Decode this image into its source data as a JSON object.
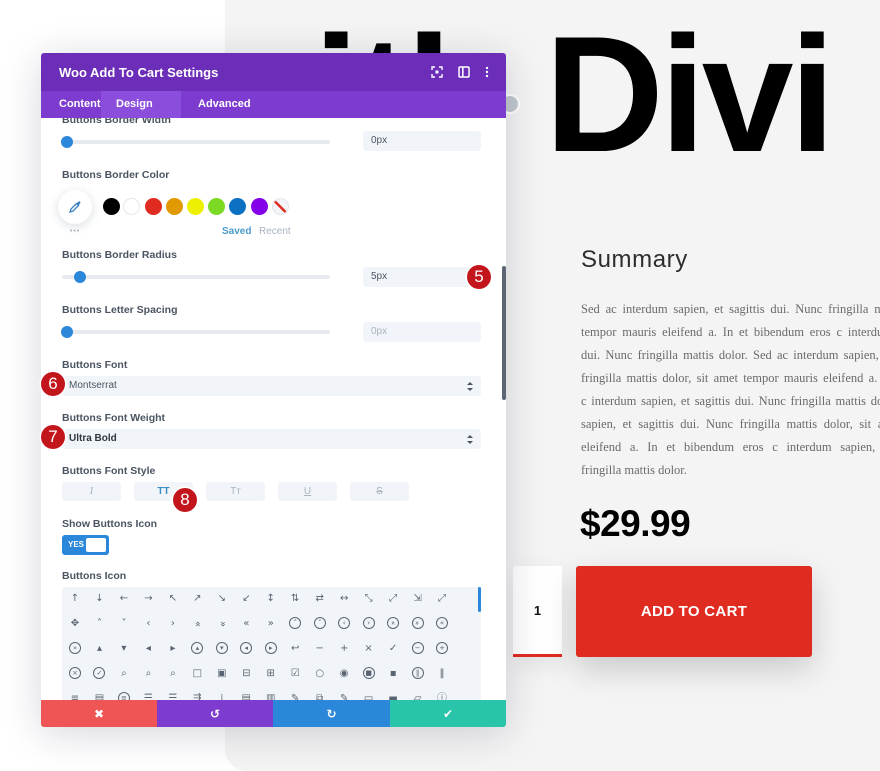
{
  "panel": {
    "title": "Woo Add To Cart Settings",
    "header_icons": [
      "expand-icon",
      "split-view-icon",
      "more-options-icon"
    ],
    "tabs": [
      {
        "label": "Content",
        "active": false
      },
      {
        "label": "Design",
        "active": true
      },
      {
        "label": "Advanced",
        "active": false
      }
    ],
    "fields": {
      "border_width": {
        "label": "Buttons Border Width",
        "value": "0px",
        "slider_position": 0
      },
      "border_color": {
        "label": "Buttons Border Color",
        "more_label": "•••",
        "saved_label": "Saved",
        "recent_label": "Recent",
        "swatches": [
          {
            "name": "black",
            "hex": "#000000"
          },
          {
            "name": "white",
            "hex": "#ffffff"
          },
          {
            "name": "red",
            "hex": "#e02b20"
          },
          {
            "name": "orange",
            "hex": "#e09900"
          },
          {
            "name": "yellow",
            "hex": "#edf000"
          },
          {
            "name": "green",
            "hex": "#7cda24"
          },
          {
            "name": "blue",
            "hex": "#0c71c3"
          },
          {
            "name": "purple",
            "hex": "#8300e9"
          },
          {
            "name": "transparent",
            "hex": "transparent"
          }
        ]
      },
      "border_radius": {
        "label": "Buttons Border Radius",
        "value": "5px",
        "slider_position": 0.05
      },
      "letter_spacing": {
        "label": "Buttons Letter Spacing",
        "value": "0px",
        "slider_position": 0
      },
      "font": {
        "label": "Buttons Font",
        "value": "Montserrat"
      },
      "font_weight": {
        "label": "Buttons Font Weight",
        "value": "Ultra Bold"
      },
      "font_style": {
        "label": "Buttons Font Style",
        "options": [
          {
            "name": "italic",
            "glyph": "I",
            "active": false
          },
          {
            "name": "uppercase",
            "glyph": "TT",
            "active": true
          },
          {
            "name": "capitalize",
            "glyph": "Tт",
            "active": false
          },
          {
            "name": "underline",
            "glyph": "U",
            "active": false
          },
          {
            "name": "strikethrough",
            "glyph": "S",
            "active": false
          }
        ]
      },
      "show_icon": {
        "label": "Show Buttons Icon",
        "value": "YES",
        "on": true
      },
      "icon": {
        "label": "Buttons Icon",
        "rows": [
          [
            {
              "n": "arrow-up",
              "g": "↑"
            },
            {
              "n": "arrow-down",
              "g": "↓"
            },
            {
              "n": "arrow-left",
              "g": "←"
            },
            {
              "n": "arrow-right",
              "g": "→"
            },
            {
              "n": "arrow-up-left",
              "g": "↖"
            },
            {
              "n": "arrow-up-right",
              "g": "↗"
            },
            {
              "n": "arrow-down-right",
              "g": "↘"
            },
            {
              "n": "arrow-down-left",
              "g": "↙"
            },
            {
              "n": "arrow-up-down",
              "g": "↕"
            },
            {
              "n": "arrows-up-down-offset",
              "g": "⇅"
            },
            {
              "n": "arrows-left-right-offset",
              "g": "⇄"
            },
            {
              "n": "arrow-left-right",
              "g": "↔"
            },
            {
              "n": "arrow-diagonal-nw-se",
              "g": "⤡"
            },
            {
              "n": "arrow-diagonal-ne-sw",
              "g": "⤢"
            },
            {
              "n": "compress",
              "g": "⇲"
            },
            {
              "n": "expand",
              "g": "⤢"
            }
          ],
          [
            {
              "n": "move",
              "g": "✥"
            },
            {
              "n": "chevron-up",
              "g": "˄"
            },
            {
              "n": "chevron-down",
              "g": "˅"
            },
            {
              "n": "chevron-left",
              "g": "‹"
            },
            {
              "n": "chevron-right",
              "g": "›"
            },
            {
              "n": "double-chevron-up",
              "g": "«",
              "r": 90
            },
            {
              "n": "double-chevron-down",
              "g": "»",
              "r": 90
            },
            {
              "n": "double-chevron-left",
              "g": "«"
            },
            {
              "n": "double-chevron-right",
              "g": "»"
            },
            {
              "n": "circle-chevron-up",
              "g": "˄",
              "c": true
            },
            {
              "n": "circle-chevron-down",
              "g": "˅",
              "c": true
            },
            {
              "n": "circle-chevron-left",
              "g": "‹",
              "c": true
            },
            {
              "n": "circle-chevron-right",
              "g": "›",
              "c": true
            },
            {
              "n": "circle-double-up",
              "g": "«",
              "r": 90,
              "c": true
            },
            {
              "n": "circle-double-down",
              "g": "»",
              "r": 90,
              "c": true
            },
            {
              "n": "circle-double-left",
              "g": "«",
              "c": true
            }
          ],
          [
            {
              "n": "circle-double-right",
              "g": "»",
              "c": true
            },
            {
              "n": "triangle-up",
              "g": "▴"
            },
            {
              "n": "triangle-down",
              "g": "▾"
            },
            {
              "n": "triangle-left",
              "g": "◂"
            },
            {
              "n": "triangle-right",
              "g": "▸"
            },
            {
              "n": "circle-triangle-up",
              "g": "▴",
              "c": true
            },
            {
              "n": "circle-triangle-down",
              "g": "▾",
              "c": true
            },
            {
              "n": "circle-triangle-left",
              "g": "◂",
              "c": true
            },
            {
              "n": "circle-triangle-right",
              "g": "▸",
              "c": true
            },
            {
              "n": "undo",
              "g": "↩"
            },
            {
              "n": "minus",
              "g": "−"
            },
            {
              "n": "plus",
              "g": "+"
            },
            {
              "n": "close",
              "g": "×"
            },
            {
              "n": "check",
              "g": "✓"
            },
            {
              "n": "circle-minus",
              "g": "−",
              "c": true
            },
            {
              "n": "circle-plus",
              "g": "+",
              "c": true
            }
          ],
          [
            {
              "n": "circle-close",
              "g": "×",
              "c": true
            },
            {
              "n": "circle-check",
              "g": "✓",
              "c": true
            },
            {
              "n": "zoom-out",
              "g": "⌕"
            },
            {
              "n": "zoom-in",
              "g": "⌕"
            },
            {
              "n": "search",
              "g": "⌕"
            },
            {
              "n": "square",
              "g": "□"
            },
            {
              "n": "square-filled",
              "g": "▣"
            },
            {
              "n": "square-minus",
              "g": "⊟"
            },
            {
              "n": "square-plus",
              "g": "⊞"
            },
            {
              "n": "square-check",
              "g": "☑"
            },
            {
              "n": "circle",
              "g": "○"
            },
            {
              "n": "circle-dot",
              "g": "◉"
            },
            {
              "n": "circle-stop",
              "g": "■",
              "c": true
            },
            {
              "n": "stop",
              "g": "▪"
            },
            {
              "n": "circle-pause",
              "g": "‖",
              "c": true
            },
            {
              "n": "pause",
              "g": "‖"
            }
          ],
          [
            {
              "n": "menu",
              "g": "≡"
            },
            {
              "n": "document",
              "g": "▤"
            },
            {
              "n": "circle-menu",
              "g": "≡",
              "c": true
            },
            {
              "n": "align-center",
              "g": "☰"
            },
            {
              "n": "align-right",
              "g": "☰"
            },
            {
              "n": "sliders-horizontal",
              "g": "⇶"
            },
            {
              "n": "sliders-vertical",
              "g": "⁞"
            },
            {
              "n": "note",
              "g": "▤"
            },
            {
              "n": "note-filled",
              "g": "▥"
            },
            {
              "n": "pen",
              "g": "✎"
            },
            {
              "n": "resize",
              "g": "⧉"
            },
            {
              "n": "pen-diagonal",
              "g": "✎"
            },
            {
              "n": "folder",
              "g": "▭"
            },
            {
              "n": "folder-filled",
              "g": "▬"
            },
            {
              "n": "folder-open",
              "g": "▱"
            },
            {
              "n": "info",
              "g": "ⓘ"
            }
          ]
        ]
      }
    },
    "footer": [
      {
        "name": "discard",
        "icon": "✖",
        "color": "#ef5555"
      },
      {
        "name": "undo",
        "icon": "↺",
        "color": "#7e3bd0"
      },
      {
        "name": "redo",
        "icon": "↻",
        "color": "#2b87da"
      },
      {
        "name": "save",
        "icon": "✔",
        "color": "#29c4a9"
      }
    ]
  },
  "annotations": [
    {
      "number": "5",
      "target": "Buttons Border Radius"
    },
    {
      "number": "6",
      "target": "Buttons Font"
    },
    {
      "number": "7",
      "target": "Buttons Font Weight"
    },
    {
      "number": "8",
      "target": "Buttons Font Style"
    }
  ],
  "product": {
    "heading": "with Divi",
    "section_title": "Summary",
    "paragraph_lines": [
      "Sed ac interdum sapien, et sagittis dui. Nunc fringilla mat",
      "tempor mauris eleifend a. In et bibendum eros c interdum",
      "dui. Nunc fringilla mattis dolor. Sed ac interdum sapien, et",
      "fringilla mattis dolor, sit amet tempor mauris eleifend a. In",
      "c interdum sapien, et sagittis dui. Nunc fringilla mattis dolo",
      "sapien, et sagittis dui. Nunc fringilla mattis dolor, sit am",
      "eleifend a. In et bibendum eros c interdum sapien, et",
      "fringilla mattis dolor."
    ],
    "price": "$29.99",
    "quantity": "1",
    "add_to_cart_label": "ADD TO CART"
  },
  "colors": {
    "header_purple": "#6c2eb9",
    "tab_purple": "#7d3bcf",
    "accent_blue": "#2b87da",
    "cart_red": "#e02b20",
    "badge_red": "#c3161c"
  }
}
